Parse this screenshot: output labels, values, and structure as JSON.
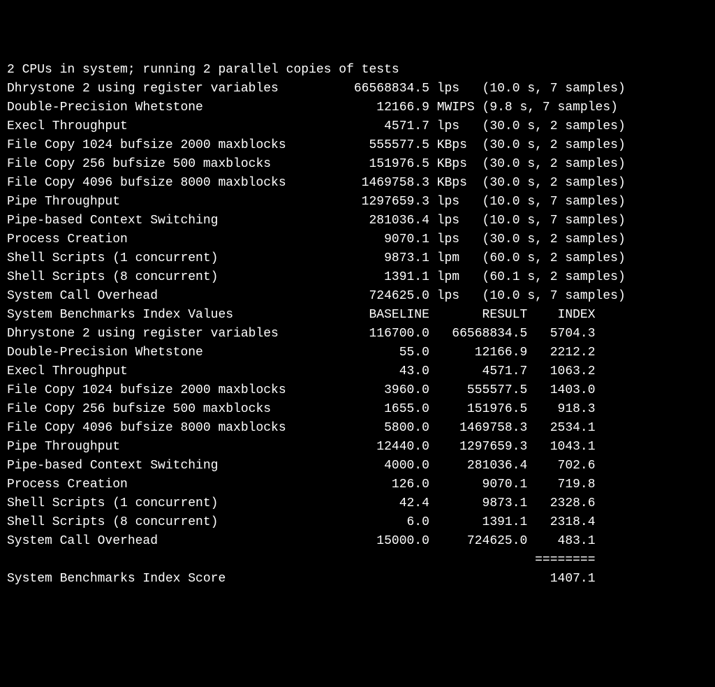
{
  "header": "2 CPUs in system; running 2 parallel copies of tests",
  "results": [
    {
      "name": "Dhrystone 2 using register variables",
      "value": "66568834.5",
      "unit": "lps",
      "time": "10.0",
      "samples": 7
    },
    {
      "name": "Double-Precision Whetstone",
      "value": "12166.9",
      "unit": "MWIPS",
      "time": "9.8",
      "samples": 7
    },
    {
      "name": "Execl Throughput",
      "value": "4571.7",
      "unit": "lps",
      "time": "30.0",
      "samples": 2
    },
    {
      "name": "File Copy 1024 bufsize 2000 maxblocks",
      "value": "555577.5",
      "unit": "KBps",
      "time": "30.0",
      "samples": 2
    },
    {
      "name": "File Copy 256 bufsize 500 maxblocks",
      "value": "151976.5",
      "unit": "KBps",
      "time": "30.0",
      "samples": 2
    },
    {
      "name": "File Copy 4096 bufsize 8000 maxblocks",
      "value": "1469758.3",
      "unit": "KBps",
      "time": "30.0",
      "samples": 2
    },
    {
      "name": "Pipe Throughput",
      "value": "1297659.3",
      "unit": "lps",
      "time": "10.0",
      "samples": 7
    },
    {
      "name": "Pipe-based Context Switching",
      "value": "281036.4",
      "unit": "lps",
      "time": "10.0",
      "samples": 7
    },
    {
      "name": "Process Creation",
      "value": "9070.1",
      "unit": "lps",
      "time": "30.0",
      "samples": 2
    },
    {
      "name": "Shell Scripts (1 concurrent)",
      "value": "9873.1",
      "unit": "lpm",
      "time": "60.0",
      "samples": 2
    },
    {
      "name": "Shell Scripts (8 concurrent)",
      "value": "1391.1",
      "unit": "lpm",
      "time": "60.1",
      "samples": 2
    },
    {
      "name": "System Call Overhead",
      "value": "724625.0",
      "unit": "lps",
      "time": "10.0",
      "samples": 7
    }
  ],
  "index_header": {
    "title": "System Benchmarks Index Values",
    "baseline": "BASELINE",
    "result": "RESULT",
    "index": "INDEX"
  },
  "index": [
    {
      "name": "Dhrystone 2 using register variables",
      "baseline": "116700.0",
      "result": "66568834.5",
      "index": "5704.3"
    },
    {
      "name": "Double-Precision Whetstone",
      "baseline": "55.0",
      "result": "12166.9",
      "index": "2212.2"
    },
    {
      "name": "Execl Throughput",
      "baseline": "43.0",
      "result": "4571.7",
      "index": "1063.2"
    },
    {
      "name": "File Copy 1024 bufsize 2000 maxblocks",
      "baseline": "3960.0",
      "result": "555577.5",
      "index": "1403.0"
    },
    {
      "name": "File Copy 256 bufsize 500 maxblocks",
      "baseline": "1655.0",
      "result": "151976.5",
      "index": "918.3"
    },
    {
      "name": "File Copy 4096 bufsize 8000 maxblocks",
      "baseline": "5800.0",
      "result": "1469758.3",
      "index": "2534.1"
    },
    {
      "name": "Pipe Throughput",
      "baseline": "12440.0",
      "result": "1297659.3",
      "index": "1043.1"
    },
    {
      "name": "Pipe-based Context Switching",
      "baseline": "4000.0",
      "result": "281036.4",
      "index": "702.6"
    },
    {
      "name": "Process Creation",
      "baseline": "126.0",
      "result": "9070.1",
      "index": "719.8"
    },
    {
      "name": "Shell Scripts (1 concurrent)",
      "baseline": "42.4",
      "result": "9873.1",
      "index": "2328.6"
    },
    {
      "name": "Shell Scripts (8 concurrent)",
      "baseline": "6.0",
      "result": "1391.1",
      "index": "2318.4"
    },
    {
      "name": "System Call Overhead",
      "baseline": "15000.0",
      "result": "724625.0",
      "index": "483.1"
    }
  ],
  "divider": "========",
  "score_label": "System Benchmarks Index Score",
  "score_value": "1407.1"
}
